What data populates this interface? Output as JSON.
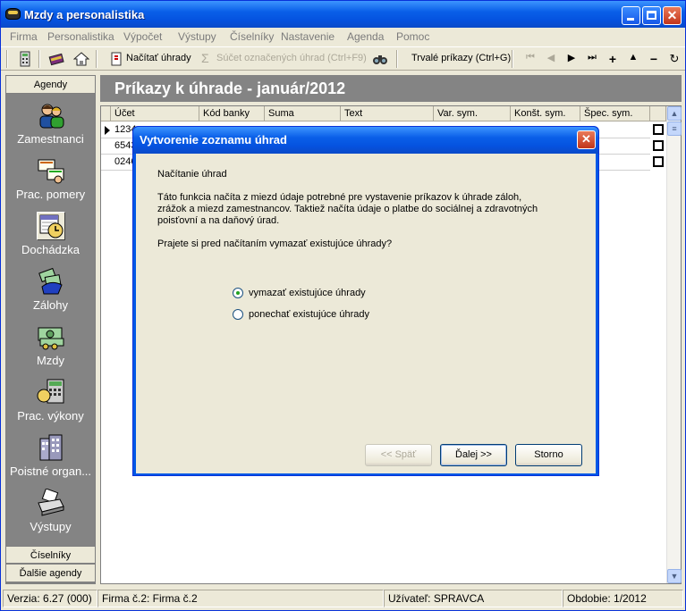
{
  "window": {
    "title": "Mzdy a personalistika"
  },
  "menu": [
    "Firma",
    "Personalistika",
    "Výpočet",
    "Výstupy",
    "Číselníky",
    "Nastavenie",
    "Agenda",
    "Pomoc"
  ],
  "toolbar": {
    "load_label": "Načítať úhrady",
    "sum_label": "Súčet označených úhrad (Ctrl+F9)",
    "standing_label": "Trvalé príkazy (Ctrl+G)"
  },
  "sidebar": {
    "header": "Agendy",
    "items": [
      {
        "label": "Zamestnanci",
        "icon": "employees-icon"
      },
      {
        "label": "Prac. pomery",
        "icon": "employment-icon"
      },
      {
        "label": "Dochádzka",
        "icon": "attendance-icon"
      },
      {
        "label": "Zálohy",
        "icon": "advances-icon"
      },
      {
        "label": "Mzdy",
        "icon": "wages-icon"
      },
      {
        "label": "Prac. výkony",
        "icon": "work-performance-icon"
      },
      {
        "label": "Poistné organ...",
        "icon": "insurance-icon"
      },
      {
        "label": "Výstupy",
        "icon": "printer-icon"
      }
    ],
    "footer1": "Číselníky",
    "footer2": "Ďalšie agendy"
  },
  "content": {
    "title": "Príkazy k úhrade - január/2012"
  },
  "grid": {
    "columns": [
      "Účet",
      "Kód banky",
      "Suma",
      "Text",
      "Var. sym.",
      "Konšt. sym.",
      "Špec. sym."
    ],
    "rows": [
      {
        "account": "1234"
      },
      {
        "account": "6543"
      },
      {
        "account": "0246"
      }
    ]
  },
  "dialog": {
    "title": "Vytvorenie zoznamu úhrad",
    "heading": "Načítanie úhrad",
    "line1": "Táto funkcia načíta z miezd údaje potrebné pre vystavenie príkazov k úhrade  záloh,",
    "line2": "zrážok a miezd zamestnancov. Taktiež načíta údaje o platbe do  sociálnej a zdravotných",
    "line3": "poisťovní a na daňový úrad.",
    "question": "Prajete si pred načítaním vymazať existujúce úhrady?",
    "option1": "vymazať existujúce úhrady",
    "option2": "ponechať existujúce úhrady",
    "selected_option": 1,
    "back_label": "<< Späť",
    "next_label": "Ďalej >>",
    "cancel_label": "Storno"
  },
  "status": {
    "version": "Verzia: 6.27 (000)",
    "company": "Firma č.2: Firma č.2",
    "user": "Užívateľ: SPRAVCA",
    "period": "Obdobie: 1/2012"
  }
}
